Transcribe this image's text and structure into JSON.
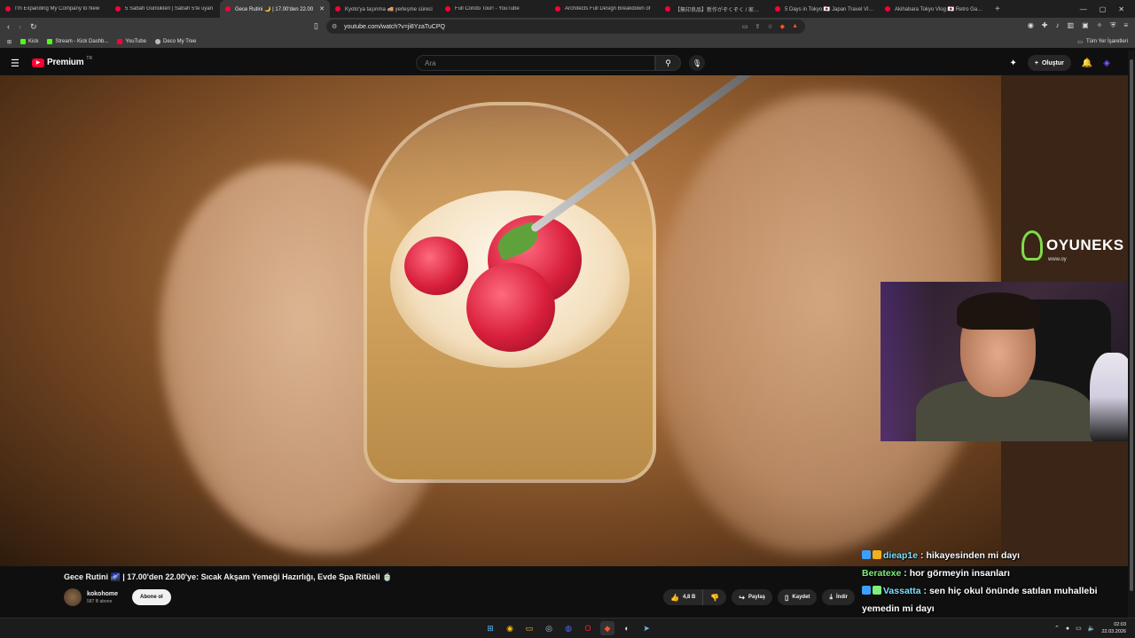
{
  "browser": {
    "tabs": [
      {
        "title": "I'm Expanding My Company to New",
        "active": false
      },
      {
        "title": "5 Sabah Günlükleri | Sabah 5'te uyan",
        "active": false
      },
      {
        "title": "Gece Rutini 🌙 | 17.00'den 22.00",
        "active": true
      },
      {
        "title": "Kyoto'ya taşınma 🚚 yerleşme süreci",
        "active": false
      },
      {
        "title": "Full Condo Tour! - YouTube",
        "active": false
      },
      {
        "title": "Architects Full Design Breakdown of",
        "active": false
      },
      {
        "title": "【無印良品】新作がぞくぞく / 家具が良き",
        "active": false
      },
      {
        "title": "5 Days in Tokyo 🇯🇵 Japan Travel Vlog",
        "active": false
      },
      {
        "title": "Akihabara Tokyo Vlog 🇯🇵 Retro Game",
        "active": false
      }
    ],
    "url": "youtube.com/watch?v=ji8YzaTuCPQ",
    "bookmarks": [
      {
        "label": "Kick",
        "color": "#53fc18"
      },
      {
        "label": "Stream - Kick Dashb...",
        "color": "#53fc18"
      },
      {
        "label": "YouTube",
        "color": "#ff0033"
      },
      {
        "label": "Deco My Tree",
        "color": "#bbbbbb"
      }
    ],
    "all_bookmarks_label": "Tüm Yer İşaretleri"
  },
  "youtube": {
    "logo_word": "Premium",
    "country_code": "TR",
    "search_placeholder": "Ara",
    "create_label": "Oluştur"
  },
  "video": {
    "watermark_brand": "OYUNEKS",
    "watermark_sub": "www.oy"
  },
  "details": {
    "title": "Gece Rutini 🌌 | 17.00'den 22.00'ye: Sıcak Akşam Yemeği Hazırlığı, Evde Spa Ritüeli 🍵",
    "channel_name": "kokohome",
    "channel_subs": "587 B abone",
    "subscribe_label": "Abone ol",
    "likes": "4,8 B",
    "share_label": "Paylaş",
    "save_label": "Kaydet",
    "download_label": "İndir"
  },
  "chat": [
    {
      "user": "dieap1e",
      "text": " : hikayesinden mi dayı",
      "color": "#7be1ff"
    },
    {
      "user": "Beratexe",
      "text": " : hor görmeyin insanları",
      "color": "#7cf07a"
    },
    {
      "user": "Vassatta",
      "text": " : sen hiç okul önünde satılan muhallebi",
      "color": "#7be1ff"
    },
    {
      "user": "",
      "text": "yemedin mi dayı",
      "color": "#ffffff"
    }
  ],
  "taskbar": {
    "time": "02:03",
    "date": "22.03.2026"
  },
  "colors": {
    "accent": "#ff0033",
    "page_bg": "#0f0f0f",
    "kick_green": "#53fc18"
  }
}
